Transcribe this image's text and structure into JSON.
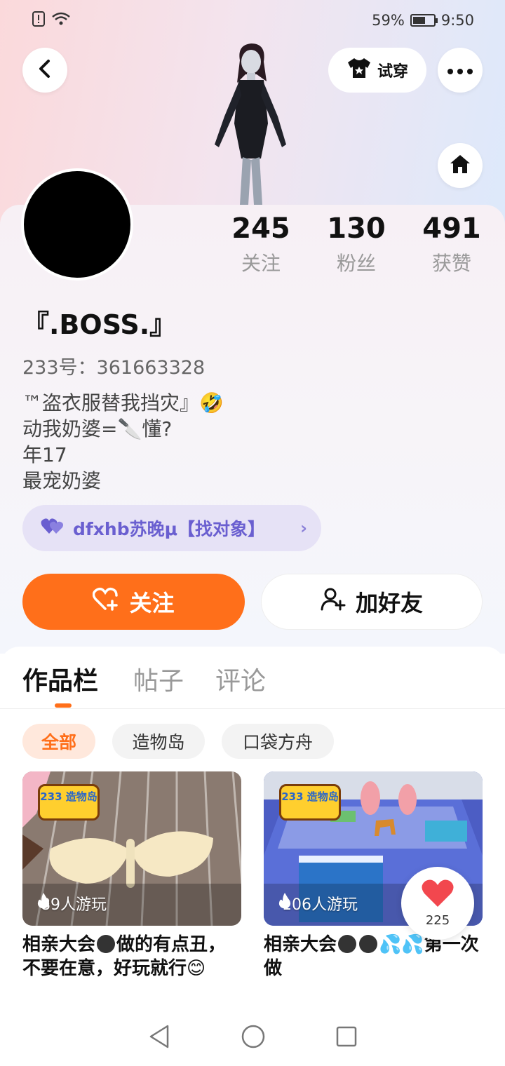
{
  "status_bar": {
    "battery": "59%",
    "time": "9:50"
  },
  "header": {
    "try_on_label": "试穿"
  },
  "stats": [
    {
      "value": "245",
      "label": "关注"
    },
    {
      "value": "130",
      "label": "粉丝"
    },
    {
      "value": "491",
      "label": "获赞"
    }
  ],
  "profile": {
    "username": "『.BOSS.』",
    "uid": "233号：361663328",
    "bio": [
      "™盗衣服替我挡灾』🤣",
      "动我奶婆=🔪懂?",
      "年17",
      "最宠奶婆"
    ],
    "partner_label": "dfxhb苏晚μ【找对象】"
  },
  "actions": {
    "follow_label": "关注",
    "add_friend_label": "加好友"
  },
  "tabs": [
    "作品栏",
    "帖子",
    "评论"
  ],
  "filters": [
    "全部",
    "造物岛",
    "口袋方舟"
  ],
  "works": [
    {
      "logo": "233 造物岛",
      "plays": "89人游玩",
      "title": "相亲大会",
      "title_rest": "做的有点丑，不要在意，好玩就行😊"
    },
    {
      "logo": "233 造物岛",
      "plays": "106人游玩",
      "title": "相亲大会",
      "title_rest": "💦💦第一次做"
    }
  ],
  "like_count": "225",
  "colors": {
    "accent": "#ff6f1a",
    "partner": "#6a5fd0"
  }
}
